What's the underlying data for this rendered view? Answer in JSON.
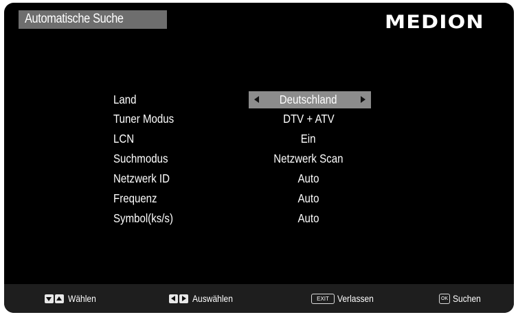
{
  "header": {
    "title": "Automatische Suche",
    "brand": "MEDION"
  },
  "settings": [
    {
      "label": "Land",
      "value": "Deutschland",
      "selected": true
    },
    {
      "label": "Tuner Modus",
      "value": "DTV + ATV"
    },
    {
      "label": "LCN",
      "value": "Ein"
    },
    {
      "label": "Suchmodus",
      "value": "Netzwerk Scan"
    },
    {
      "label": "Netzwerk ID",
      "value": "Auto"
    },
    {
      "label": "Frequenz",
      "value": "Auto"
    },
    {
      "label": "Symbol(ks/s)",
      "value": "Auto"
    }
  ],
  "footer": {
    "select": {
      "label": "Wählen",
      "icon": "up-down-keys-icon"
    },
    "choose": {
      "label": "Auswählen",
      "icon": "left-right-keys-icon"
    },
    "exit": {
      "key": "EXIT",
      "label": "Verlassen",
      "icon": "exit-key-icon"
    },
    "search": {
      "key": "OK",
      "label": "Suchen",
      "icon": "ok-key-icon"
    }
  },
  "colors": {
    "background": "#000000",
    "title_bar": "#6e6e6e",
    "selected_row": "#8c8c8c",
    "footer": "#1e1e1e",
    "text": "#ffffff"
  }
}
